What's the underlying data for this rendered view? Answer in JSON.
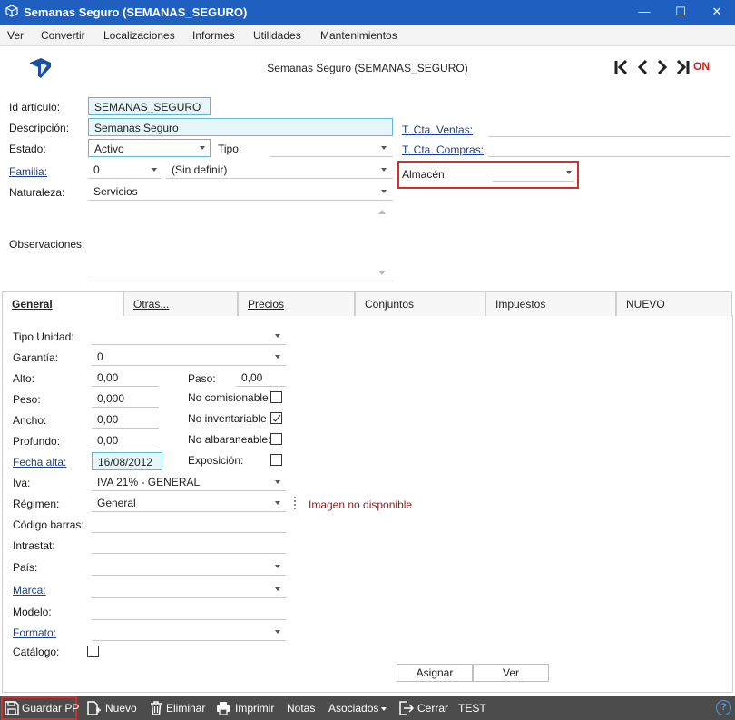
{
  "window": {
    "title": "Semanas Seguro (SEMANAS_SEGURO)",
    "minimize": "—",
    "maximize": "☐",
    "close": "✕"
  },
  "menu": [
    "Ver",
    "Convertir",
    "Localizaciones",
    "Informes",
    "Utilidades",
    "Mantenimientos"
  ],
  "header": {
    "title": "Semanas Seguro (SEMANAS_SEGURO)",
    "on_label": "ON"
  },
  "form": {
    "id_label": "Id artículo:",
    "id_value": "SEMANAS_SEGURO",
    "desc_label": "Descripción:",
    "desc_value": "Semanas Seguro",
    "estado_label": "Estado:",
    "estado_value": "Activo",
    "tipo_label": "Tipo:",
    "tipo_value": "",
    "familia_label": "Familia:",
    "familia_code": "0",
    "familia_value": "(Sin definir)",
    "naturaleza_label": "Naturaleza:",
    "naturaleza_value": "Servicios",
    "observaciones_label": "Observaciones:",
    "cta_ventas_label": "T. Cta. Ventas:",
    "cta_compras_label": "T. Cta. Compras:",
    "almacen_label": "Almacén:"
  },
  "tabs": [
    "General",
    "Otras...",
    "Precios",
    "Conjuntos",
    "Impuestos",
    "NUEVO"
  ],
  "general": {
    "tipo_unidad_label": "Tipo Unidad:",
    "garantia_label": "Garantía:",
    "garantia_value": "0",
    "alto_label": "Alto:",
    "alto_value": "0,00",
    "paso_label": "Paso:",
    "paso_value": "0,00",
    "peso_label": "Peso:",
    "peso_value": "0,000",
    "no_comisionable_label": "No comisionable",
    "ancho_label": "Ancho:",
    "ancho_value": "0,00",
    "no_inventariable_label": "No inventariable",
    "profundo_label": "Profundo:",
    "profundo_value": "0,00",
    "no_albaraneable_label": "No albaraneable:",
    "fecha_alta_label": "Fecha alta:",
    "fecha_alta_value": "16/08/2012",
    "exposicion_label": "Exposición:",
    "iva_label": "Iva:",
    "iva_value": "IVA 21% - GENERAL",
    "regimen_label": "Régimen:",
    "regimen_value": "General",
    "imagen_label": "Imagen no disponible",
    "codigo_barras_label": "Código barras:",
    "intrastat_label": "Intrastat:",
    "pais_label": "País:",
    "marca_label": "Marca:",
    "modelo_label": "Modelo:",
    "formato_label": "Formato:",
    "catalogo_label": "Catálogo:",
    "asignar_label": "Asignar",
    "ver_label": "Ver"
  },
  "checkboxes": {
    "no_comisionable": false,
    "no_inventariable": true,
    "no_albaraneable": false,
    "exposicion": false,
    "catalogo": false
  },
  "toolbar": {
    "guardar": "Guardar PP",
    "nuevo": "Nuevo",
    "eliminar": "Eliminar",
    "imprimir": "Imprimir",
    "notas": "Notas",
    "asociados": "Asociados",
    "cerrar": "Cerrar",
    "test": "TEST",
    "help": "?"
  },
  "colors": {
    "titlebar": "#1f5fbf",
    "accent_red": "#d32f2f",
    "toolbar": "#4c4c4c",
    "field_highlight": "#e6f6fb"
  }
}
